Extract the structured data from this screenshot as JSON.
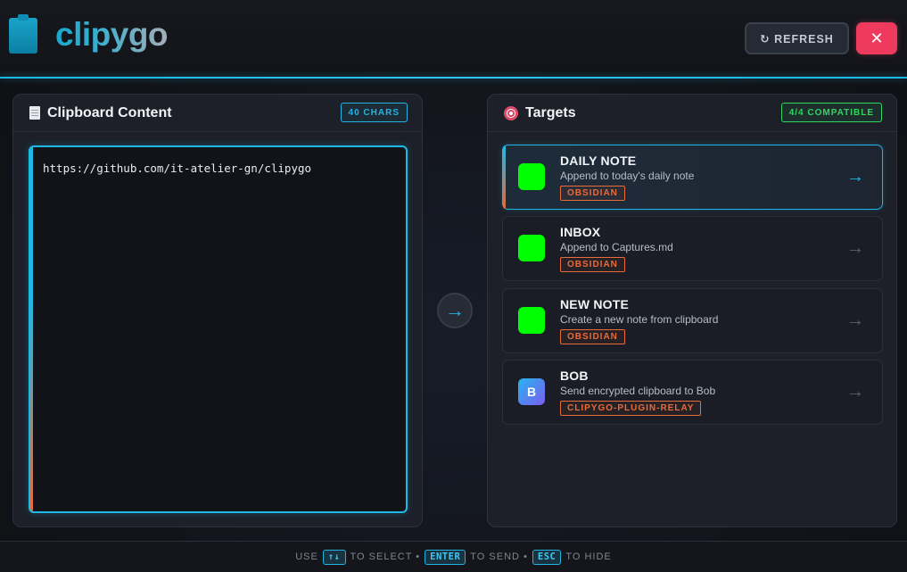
{
  "app": {
    "name": "clipygo",
    "refresh_label": "↻ REFRESH",
    "close_label": "✕"
  },
  "clipboard": {
    "title": "Clipboard Content",
    "char_badge": "40 CHARS",
    "content": "https://github.com/it-atelier-gn/clipygo"
  },
  "send_button": "→",
  "targets": {
    "title": "Targets",
    "compat_badge": "4/4 COMPATIBLE",
    "items": [
      {
        "name": "DAILY NOTE",
        "desc": "Append to today's daily note",
        "tag": "OBSIDIAN",
        "icon": "green-square-icon",
        "arrow": "→"
      },
      {
        "name": "INBOX",
        "desc": "Append to Captures.md",
        "tag": "OBSIDIAN",
        "icon": "green-square-icon",
        "arrow": "→"
      },
      {
        "name": "NEW NOTE",
        "desc": "Create a new note from clipboard",
        "tag": "OBSIDIAN",
        "icon": "green-square-icon",
        "arrow": "→"
      },
      {
        "name": "BOB",
        "desc": "Send encrypted clipboard to Bob",
        "tag": "CLIPYGO-PLUGIN-RELAY",
        "icon_letter": "B",
        "arrow": "→"
      }
    ]
  },
  "footer": {
    "use": "USE",
    "key_select": "↑↓",
    "to_select": "TO SELECT •",
    "key_send": "ENTER",
    "to_send": "TO SEND •",
    "key_hide": "ESC",
    "to_hide": "TO HIDE"
  },
  "colors": {
    "accent": "#22b4e3",
    "close": "#ee3b5d",
    "tag": "#ea6a3a",
    "compat": "#2fd65f",
    "target_icon": "#00ff00"
  }
}
